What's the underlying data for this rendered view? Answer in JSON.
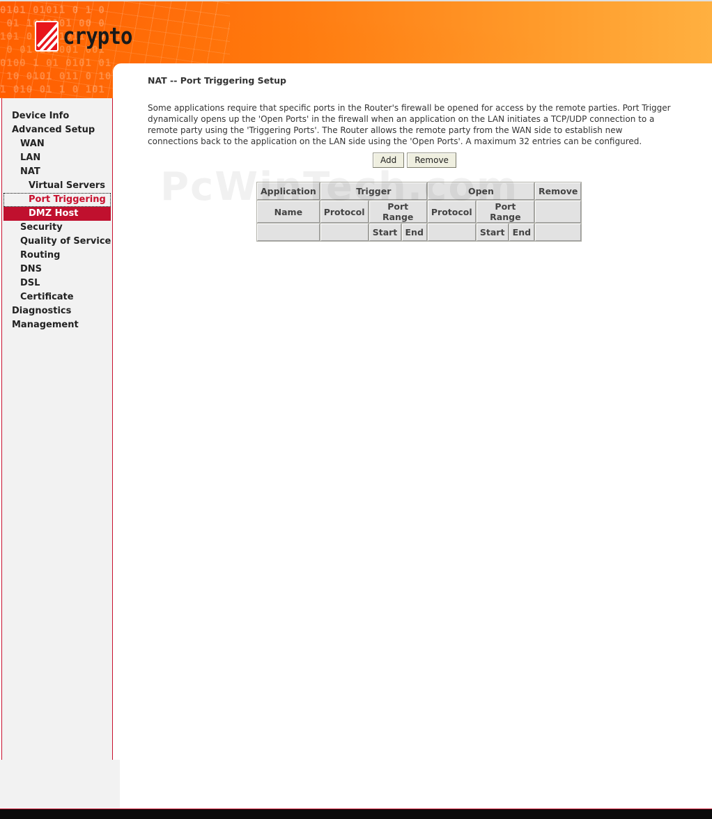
{
  "header": {
    "logo_text": "crypto",
    "logo_icon": "crypto-logo-mark",
    "brand_color": "#ff6a00",
    "accent_color": "#c8102e"
  },
  "sidebar": {
    "items": [
      {
        "label": "Device Info"
      },
      {
        "label": "Advanced Setup"
      },
      {
        "label": "WAN"
      },
      {
        "label": "LAN"
      },
      {
        "label": "NAT"
      },
      {
        "label": "Virtual Servers"
      },
      {
        "label": "Port Triggering"
      },
      {
        "label": "DMZ Host"
      },
      {
        "label": "Security"
      },
      {
        "label": "Quality of Service"
      },
      {
        "label": "Routing"
      },
      {
        "label": "DNS"
      },
      {
        "label": "DSL"
      },
      {
        "label": "Certificate"
      },
      {
        "label": "Diagnostics"
      },
      {
        "label": "Management"
      }
    ]
  },
  "main": {
    "title": "NAT -- Port Triggering Setup",
    "description": "Some applications require that specific ports in the Router's firewall be opened for access by the remote parties. Port Trigger dynamically opens up the 'Open Ports' in the firewall when an application on the LAN initiates a TCP/UDP connection to a remote party using the 'Triggering Ports'. The Router allows the remote party from the WAN side to establish new connections back to the application on the LAN side using the 'Open Ports'. A maximum 32 entries can be configured.",
    "add_label": "Add",
    "remove_label": "Remove",
    "watermark": "PcWinTech.com"
  },
  "table": {
    "header1": {
      "application": "Application",
      "trigger": "Trigger",
      "open": "Open",
      "remove": "Remove"
    },
    "header2": {
      "name": "Name",
      "trigger_protocol": "Protocol",
      "trigger_port_range": "Port Range",
      "open_protocol": "Protocol",
      "open_port_range": "Port Range"
    },
    "header3": {
      "trigger_start": "Start",
      "trigger_end": "End",
      "open_start": "Start",
      "open_end": "End"
    },
    "rows": []
  }
}
